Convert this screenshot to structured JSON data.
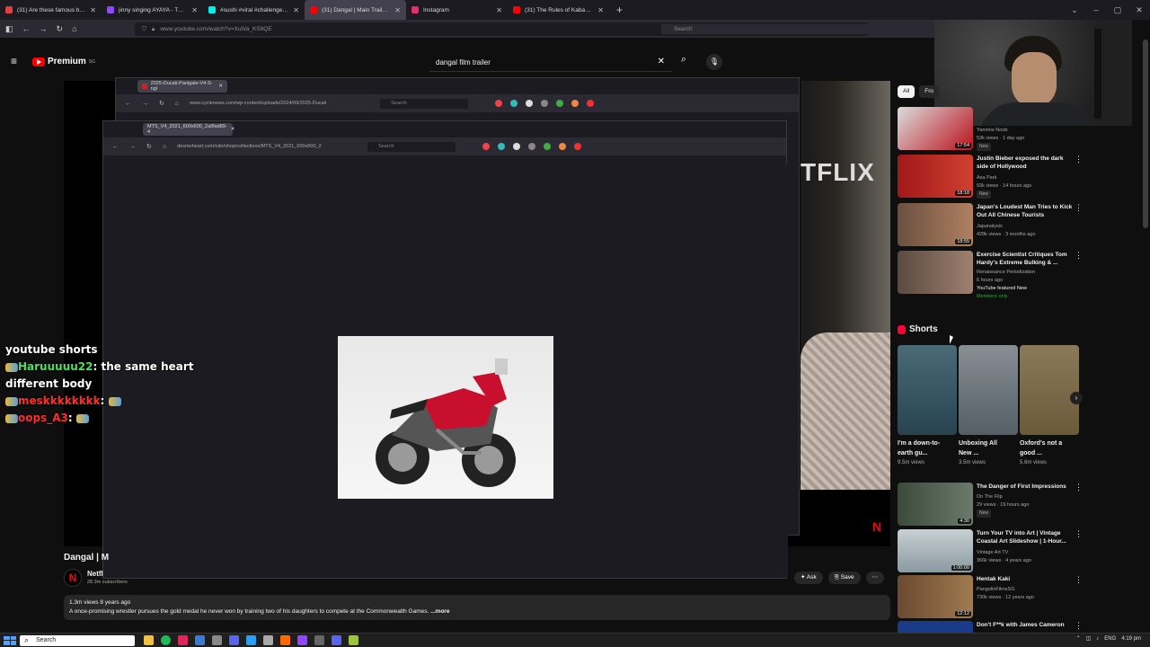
{
  "browser": {
    "tabs": [
      {
        "label": "(31) Are these famous butter c",
        "color": "#e04040",
        "active": false
      },
      {
        "label": "jinny singing AYAYA - Twitch",
        "color": "#9146ff",
        "active": false
      },
      {
        "label": "#sushi #viral #challenge #pozzi",
        "color": "#00f2ea",
        "active": false
      },
      {
        "label": "(31) Dangal | Main Trailer | Netf",
        "color": "#ff0000",
        "active": true
      },
      {
        "label": "Instagram",
        "color": "#e1306c",
        "active": false
      },
      {
        "label": "(31) The Rules of Kabaddi - EX",
        "color": "#ff0000",
        "active": false
      }
    ],
    "url": "www.youtube.com/watch?v=XulVa_KS9QE",
    "search_placeholder": "Search"
  },
  "youtube": {
    "logo": "Premium",
    "logo_sup": "SG",
    "search_query": "dangal film trailer"
  },
  "overlay_windows": {
    "win1": {
      "tab": "2025-Ducati-Panigale-V4-S-ngl",
      "url": "www.cyclenews.com/wp-content/uploads/2024/09/2025-Ducati",
      "search": "Search"
    },
    "win2": {
      "tab": "MTS_V4_2021_600x600_2a9fad89-4",
      "url": "desmoheart.com/cdn/shop/collections/MTS_V4_2021_600x600_2",
      "search": "Search"
    }
  },
  "player": {
    "netflix_text": "TFLIX",
    "netflix_logo": "N"
  },
  "chat": {
    "lines": [
      {
        "user": "",
        "text": "youtube shorts"
      },
      {
        "user": "Haruuuuu22",
        "text": "the same heart different body"
      },
      {
        "user": "meskkkkkkkk",
        "text": ""
      },
      {
        "user": "oops_A3",
        "text": ""
      }
    ]
  },
  "video": {
    "title": "Dangal | M",
    "channel": "Netfl",
    "subscribers": "28.3m subscribers",
    "actions": [
      "Ask",
      "Save"
    ],
    "more_icon": "more-dots-icon",
    "description_stats": "1.3m views  8 years ago",
    "description": "A once-promising wrestler pursues the gold medal he never won by training two of his daughters to compete at the Commonwealth Games.",
    "more_label": "...more"
  },
  "sidebar": {
    "chips": [
      "All",
      "Fro"
    ],
    "recommendations": [
      {
        "title": "",
        "channel": "Yammie Noob",
        "stats": "53k views · 1 day ago",
        "badge": "New",
        "duration": "17:54",
        "thumb": "#b8121b"
      },
      {
        "title": "Justin Bieber exposed the dark side of Hollywood",
        "channel": "Asa Park",
        "stats": "93k views · 14 hours ago",
        "badge": "New",
        "duration": "18:18",
        "thumb": "#8a1a18"
      },
      {
        "title": "Japan's Loudest Man Tries to Kick Out All Chinese Tourists",
        "channel": "Japanalysis",
        "stats": "428k views · 3 months ago",
        "badge": "",
        "duration": "18:55",
        "thumb": "#6a5040"
      },
      {
        "title": "Exercise Scientist Critiques Tom Hardy's Extreme Bulking & ...",
        "channel": "Renaissance Periodization",
        "stats": "6 hours ago",
        "badge": "YouTube featured  New",
        "extra": "Members only",
        "duration": "",
        "thumb": "#5a4a40"
      }
    ],
    "shorts_title": "Shorts",
    "shorts": [
      {
        "title": "I'm a down-to-earth gu...",
        "views": "9.5m views",
        "thumb": "#27444f"
      },
      {
        "title": "Unboxing All New ...",
        "views": "3.5m views",
        "thumb": "#555e66"
      },
      {
        "title": "Oxford's not a good ...",
        "views": "5.6m views",
        "thumb": "#6a5a3a"
      }
    ],
    "more_recs": [
      {
        "title": "The Danger of First Impressions",
        "channel": "On The Flip",
        "stats": "29 views · 19 hours ago",
        "badge": "New",
        "duration": "4:30",
        "thumb": "#3b4a3a"
      },
      {
        "title": "Turn Your TV into Art | Vintage Coastal Art Slideshow | 1-Hour...",
        "channel": "Vintage Art TV",
        "stats": "366k views · 4 years ago",
        "badge": "",
        "duration": "1:00:00",
        "thumb": "#8a9aa0"
      },
      {
        "title": "Hentak Kaki",
        "channel": "PangolinFilmsSG",
        "stats": "730k views · 12 years ago",
        "badge": "",
        "duration": "12:12",
        "thumb": "#6a4a30"
      },
      {
        "title": "Don't F**k with James Cameron",
        "channel": "",
        "stats": "",
        "badge": "",
        "duration": "",
        "thumb": "#1a3a8a"
      }
    ]
  },
  "taskbar": {
    "search": "Search",
    "tray": [
      "ENG",
      "4:19 pm"
    ]
  }
}
